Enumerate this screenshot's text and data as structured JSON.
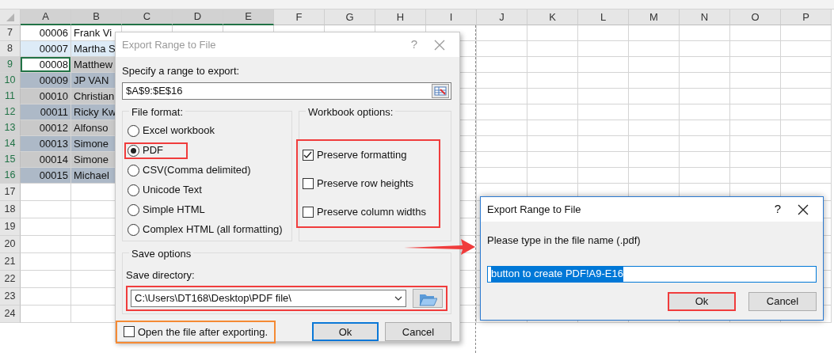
{
  "sheet": {
    "columns": [
      {
        "label": "A",
        "selected": true
      },
      {
        "label": "B",
        "selected": true
      },
      {
        "label": "C",
        "selected": true
      },
      {
        "label": "D",
        "selected": true
      },
      {
        "label": "E",
        "selected": true
      },
      {
        "label": "F",
        "selected": false
      },
      {
        "label": "G",
        "selected": false
      },
      {
        "label": "H",
        "selected": false
      },
      {
        "label": "I",
        "selected": false
      },
      {
        "label": "J",
        "selected": false
      },
      {
        "label": "K",
        "selected": false
      },
      {
        "label": "L",
        "selected": false
      },
      {
        "label": "M",
        "selected": false
      },
      {
        "label": "N",
        "selected": false
      },
      {
        "label": "O",
        "selected": false
      },
      {
        "label": "P",
        "selected": false
      }
    ],
    "rows": [
      {
        "number": "7",
        "cells": [
          "00006",
          "Frank Vi"
        ],
        "selected": false,
        "active": false,
        "banded": false
      },
      {
        "number": "8",
        "cells": [
          "00007",
          "Martha S"
        ],
        "selected": false,
        "active": false,
        "banded": true
      },
      {
        "number": "9",
        "cells": [
          "00008",
          "Matthew"
        ],
        "selected": true,
        "active": true,
        "banded": false
      },
      {
        "number": "10",
        "cells": [
          "00009",
          "JP VAN"
        ],
        "selected": true,
        "active": false,
        "banded": true
      },
      {
        "number": "11",
        "cells": [
          "00010",
          "Christian"
        ],
        "selected": true,
        "active": false,
        "banded": false
      },
      {
        "number": "12",
        "cells": [
          "00011",
          "Ricky Kw"
        ],
        "selected": true,
        "active": false,
        "banded": true
      },
      {
        "number": "13",
        "cells": [
          "00012",
          "Alfonso"
        ],
        "selected": true,
        "active": false,
        "banded": false
      },
      {
        "number": "14",
        "cells": [
          "00013",
          "Simone"
        ],
        "selected": true,
        "active": false,
        "banded": true
      },
      {
        "number": "15",
        "cells": [
          "00014",
          "Simone"
        ],
        "selected": true,
        "active": false,
        "banded": false
      },
      {
        "number": "16",
        "cells": [
          "00015",
          "Michael"
        ],
        "selected": true,
        "active": false,
        "banded": true
      },
      {
        "number": "17",
        "selected": false,
        "active": false
      },
      {
        "number": "18",
        "selected": false,
        "active": false
      },
      {
        "number": "19",
        "selected": false,
        "active": false
      },
      {
        "number": "20",
        "selected": false,
        "active": false
      },
      {
        "number": "21",
        "selected": false,
        "active": false
      },
      {
        "number": "22",
        "selected": false,
        "active": false
      },
      {
        "number": "23",
        "selected": false,
        "active": false
      },
      {
        "number": "24",
        "selected": false,
        "active": false
      }
    ]
  },
  "export_dialog": {
    "title": "Export Range to File",
    "active": false,
    "help_label": "?",
    "range_label": "Specify a range to export:",
    "range_value": "$A$9:$E$16",
    "file_format": {
      "title": "File format:",
      "options": [
        {
          "label": "Excel workbook",
          "selected": false
        },
        {
          "label": "PDF",
          "selected": true,
          "color": "#f03c3c"
        },
        {
          "label": "CSV(Comma delimited)",
          "selected": false
        },
        {
          "label": "Unicode Text",
          "selected": false
        },
        {
          "label": "Simple HTML",
          "selected": false
        },
        {
          "label": "Complex HTML (all formatting)",
          "selected": false
        }
      ]
    },
    "workbook_options": {
      "title": "Workbook options:",
      "color": "#f03c3c",
      "options": [
        {
          "label": "Preserve formatting",
          "checked": true
        },
        {
          "label": "Preserve row heights",
          "checked": false
        },
        {
          "label": "Preserve column widths",
          "checked": false
        }
      ]
    },
    "save_options": {
      "title": "Save options",
      "directory_label": "Save directory:",
      "directory": "C:\\Users\\DT168\\Desktop\\PDF file\\",
      "color": "#f03c3c"
    },
    "open_after": {
      "label": "Open the file after exporting.",
      "checked": false,
      "color": "#f58a34"
    },
    "buttons": [
      {
        "label": "Ok",
        "default": true
      },
      {
        "label": "Cancel",
        "default": false
      }
    ]
  },
  "filename_dialog": {
    "title": "Export Range to File",
    "active": true,
    "help_label": "?",
    "prompt": "Please type in the file name (.pdf)",
    "value": "button to create PDF!A9-E16",
    "value_selected": true,
    "buttons": [
      {
        "label": "Ok",
        "color": "#f03c3c"
      },
      {
        "label": "Cancel"
      }
    ]
  }
}
